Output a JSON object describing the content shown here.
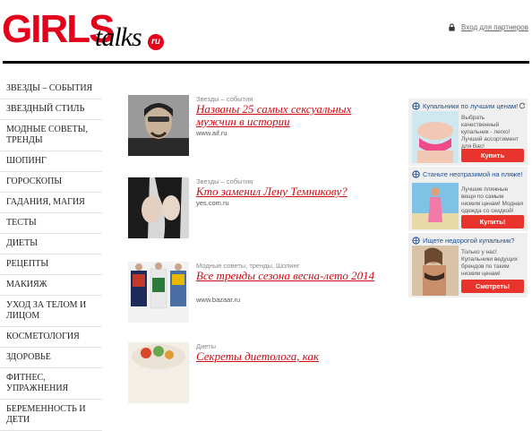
{
  "header": {
    "logo_main": "GIRLS",
    "logo_sub": "talks",
    "logo_ru": "ru",
    "partner_link": "Вход для партнеров"
  },
  "nav": {
    "items": [
      {
        "label": "ЗВЕЗДЫ – СОБЫТИЯ"
      },
      {
        "label": "ЗВЕЗДНЫЙ СТИЛЬ"
      },
      {
        "label": "МОДНЫЕ СОВЕТЫ, ТРЕНДЫ"
      },
      {
        "label": "ШОПИНГ"
      },
      {
        "label": "ГОРОСКОПЫ"
      },
      {
        "label": "ГАДАНИЯ, МАГИЯ"
      },
      {
        "label": "ТЕСТЫ"
      },
      {
        "label": "ДИЕТЫ"
      },
      {
        "label": "РЕЦЕПТЫ"
      },
      {
        "label": "МАКИЯЖ"
      },
      {
        "label": "УХОД ЗА ТЕЛОМ И ЛИЦОМ"
      },
      {
        "label": "КОСМЕТОЛОГИЯ"
      },
      {
        "label": "ЗДОРОВЬЕ"
      },
      {
        "label": "ФИТНЕС, УПРАЖНЕНИЯ"
      },
      {
        "label": "БЕРЕМЕННОСТЬ И ДЕТИ"
      }
    ]
  },
  "articles": [
    {
      "category": "Звезды – события",
      "title": "Названы 25 самых сексуальных мужчин в истории",
      "source": "www.aif.ru"
    },
    {
      "category": "Звезды – события",
      "title": "Кто заменил Лену Темникову?",
      "source": "yes.com.ru"
    },
    {
      "category": "Модные советы, тренды, Шопинг",
      "title": "Все тренды сезона весна-лето 2014",
      "source": "www.bazaar.ru"
    },
    {
      "category": "Диеты",
      "title": "Секреты диетолога, как",
      "source": ""
    }
  ],
  "ads": [
    {
      "heading": "Купальники по лучшим ценам!",
      "text": "Выбрать качественный купальник - легко! Лучший ассортимент для Вас!",
      "button": "Купить"
    },
    {
      "heading": "Станьте неотразимой на пляже!",
      "text": "Лучшие пляжные вещи по самым низким ценам! Модная одежда со скидкой!",
      "button": "Купить!"
    },
    {
      "heading": "Ищете недорогой купальник?",
      "text": "Только у нас! Купальники ведущих брендов по таким низким ценам!",
      "button": "Смотреть!"
    }
  ],
  "colors": {
    "brand_red": "#e3001b",
    "title_red": "#cf0a14",
    "button_red": "#e8342c",
    "ad_link_blue": "#1f4e8c"
  }
}
